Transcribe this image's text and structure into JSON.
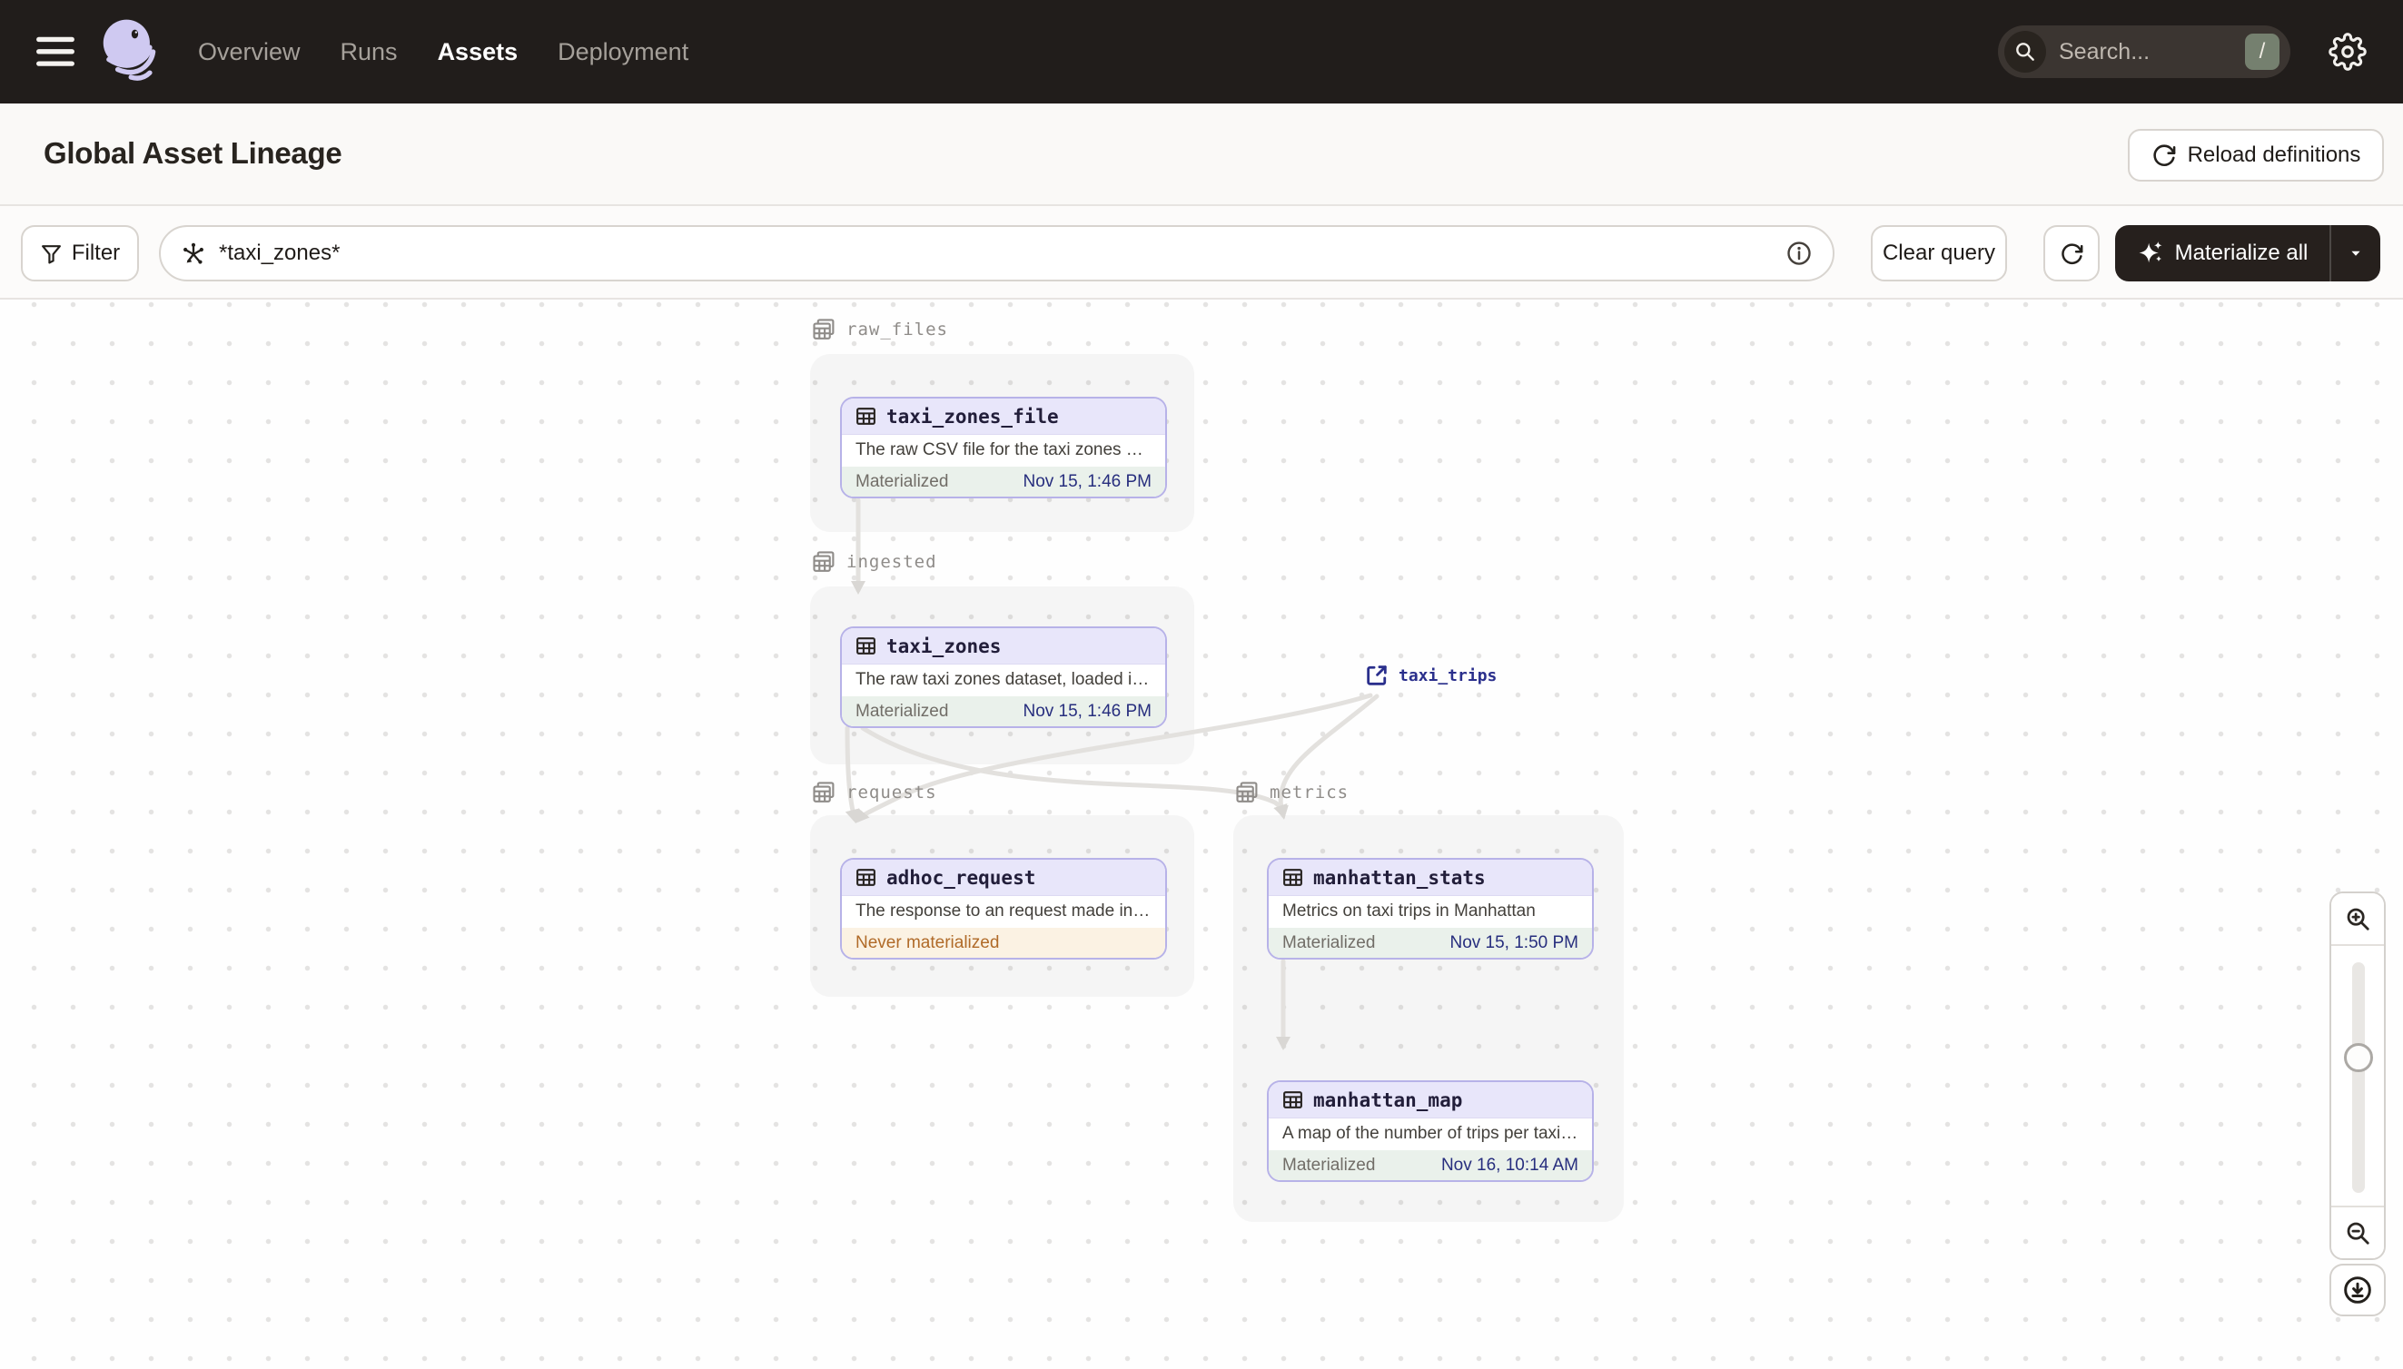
{
  "topbar": {
    "nav": [
      "Overview",
      "Runs",
      "Assets",
      "Deployment"
    ],
    "active_tab": "Assets",
    "search": {
      "placeholder": "Search...",
      "shortcut": "/"
    }
  },
  "page": {
    "title": "Global Asset Lineage",
    "reload_button": "Reload definitions"
  },
  "toolbar": {
    "filter_button": "Filter",
    "query_value": "*taxi_zones*",
    "clear_button": "Clear query",
    "materialize_button": "Materialize all"
  },
  "graph": {
    "groups": [
      {
        "name": "raw_files"
      },
      {
        "name": "ingested"
      },
      {
        "name": "requests"
      },
      {
        "name": "metrics"
      }
    ],
    "nodes": [
      {
        "name": "taxi_zones_file",
        "group": "raw_files",
        "description": "The raw CSV file for the taxi zones dat...",
        "status": "Materialized",
        "timestamp": "Nov 15, 1:46 PM"
      },
      {
        "name": "taxi_zones",
        "group": "ingested",
        "description": "The raw taxi zones dataset, loaded int...",
        "status": "Materialized",
        "timestamp": "Nov 15, 1:46 PM"
      },
      {
        "name": "adhoc_request",
        "group": "requests",
        "description": "The response to an request made in th...",
        "status": "Never materialized",
        "timestamp": ""
      },
      {
        "name": "manhattan_stats",
        "group": "metrics",
        "description": "Metrics on taxi trips in Manhattan",
        "status": "Materialized",
        "timestamp": "Nov 15, 1:50 PM"
      },
      {
        "name": "manhattan_map",
        "group": "metrics",
        "description": "A map of the number of trips per taxi z...",
        "status": "Materialized",
        "timestamp": "Nov 16, 10:14 AM"
      }
    ],
    "external_assets": [
      {
        "name": "taxi_trips"
      }
    ],
    "edges": [
      {
        "from": "taxi_zones_file",
        "to": "taxi_zones"
      },
      {
        "from": "taxi_zones",
        "to": "adhoc_request"
      },
      {
        "from": "taxi_zones",
        "to": "manhattan_stats"
      },
      {
        "from": "taxi_trips",
        "to": "adhoc_request"
      },
      {
        "from": "taxi_trips",
        "to": "manhattan_stats"
      },
      {
        "from": "manhattan_stats",
        "to": "manhattan_map"
      }
    ]
  },
  "icons": {
    "menu": "hamburger",
    "logo": "dagster-octopus",
    "search": "magnifier",
    "settings": "gear",
    "reload": "circular-arrow",
    "filter": "funnel",
    "query": "graph-selector",
    "info": "info-circle",
    "materialize": "sparkles",
    "dropdown": "caret-down",
    "asset": "table",
    "group": "table-stack",
    "external_asset": "arrow-up-right-square",
    "zoom_in": "magnifier-plus",
    "zoom_out": "magnifier-minus",
    "download": "download-circle"
  },
  "colors": {
    "header_bg": "#211D1B",
    "page_bg": "#FAF9F7",
    "node_border": "#B7B2E8",
    "node_header_bg": "#E8E6FA",
    "materialized_bg": "#EAF1EB",
    "timestamp_text": "#272E7E",
    "never_materialized_bg": "#FBF2E3",
    "never_materialized_text": "#B06A28",
    "edge": "#E3E1DE",
    "external_asset_text": "#2A2F8C",
    "shortcut_badge": "#75806F"
  }
}
